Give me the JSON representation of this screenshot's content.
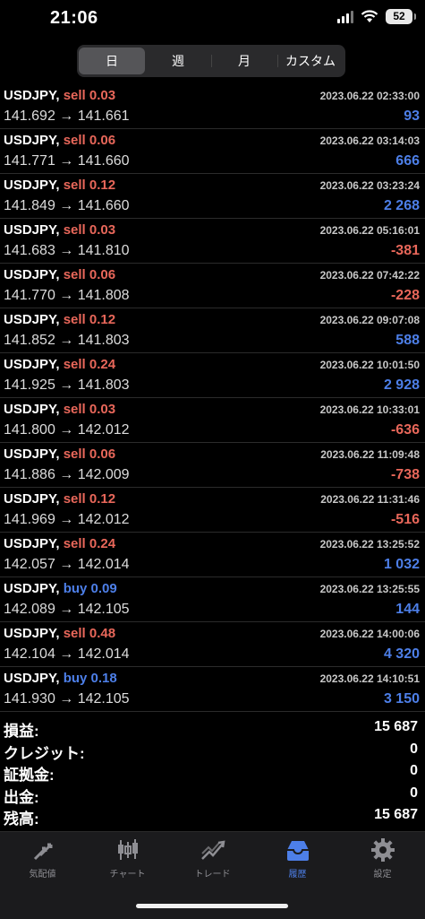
{
  "status": {
    "time": "21:06",
    "battery": "52"
  },
  "period_tabs": [
    "日",
    "週",
    "月",
    "カスタム"
  ],
  "trades": [
    {
      "symbol": "USDJPY,",
      "side": "sell",
      "volume": "0.03",
      "open": "141.692",
      "close": "141.661",
      "datetime": "2023.06.22 02:33:00",
      "profit": "93",
      "sign": "pos"
    },
    {
      "symbol": "USDJPY,",
      "side": "sell",
      "volume": "0.06",
      "open": "141.771",
      "close": "141.660",
      "datetime": "2023.06.22 03:14:03",
      "profit": "666",
      "sign": "pos"
    },
    {
      "symbol": "USDJPY,",
      "side": "sell",
      "volume": "0.12",
      "open": "141.849",
      "close": "141.660",
      "datetime": "2023.06.22 03:23:24",
      "profit": "2 268",
      "sign": "pos"
    },
    {
      "symbol": "USDJPY,",
      "side": "sell",
      "volume": "0.03",
      "open": "141.683",
      "close": "141.810",
      "datetime": "2023.06.22 05:16:01",
      "profit": "-381",
      "sign": "neg"
    },
    {
      "symbol": "USDJPY,",
      "side": "sell",
      "volume": "0.06",
      "open": "141.770",
      "close": "141.808",
      "datetime": "2023.06.22 07:42:22",
      "profit": "-228",
      "sign": "neg"
    },
    {
      "symbol": "USDJPY,",
      "side": "sell",
      "volume": "0.12",
      "open": "141.852",
      "close": "141.803",
      "datetime": "2023.06.22 09:07:08",
      "profit": "588",
      "sign": "pos"
    },
    {
      "symbol": "USDJPY,",
      "side": "sell",
      "volume": "0.24",
      "open": "141.925",
      "close": "141.803",
      "datetime": "2023.06.22 10:01:50",
      "profit": "2 928",
      "sign": "pos"
    },
    {
      "symbol": "USDJPY,",
      "side": "sell",
      "volume": "0.03",
      "open": "141.800",
      "close": "142.012",
      "datetime": "2023.06.22 10:33:01",
      "profit": "-636",
      "sign": "neg"
    },
    {
      "symbol": "USDJPY,",
      "side": "sell",
      "volume": "0.06",
      "open": "141.886",
      "close": "142.009",
      "datetime": "2023.06.22 11:09:48",
      "profit": "-738",
      "sign": "neg"
    },
    {
      "symbol": "USDJPY,",
      "side": "sell",
      "volume": "0.12",
      "open": "141.969",
      "close": "142.012",
      "datetime": "2023.06.22 11:31:46",
      "profit": "-516",
      "sign": "neg"
    },
    {
      "symbol": "USDJPY,",
      "side": "sell",
      "volume": "0.24",
      "open": "142.057",
      "close": "142.014",
      "datetime": "2023.06.22 13:25:52",
      "profit": "1 032",
      "sign": "pos"
    },
    {
      "symbol": "USDJPY,",
      "side": "buy",
      "volume": "0.09",
      "open": "142.089",
      "close": "142.105",
      "datetime": "2023.06.22 13:25:55",
      "profit": "144",
      "sign": "pos"
    },
    {
      "symbol": "USDJPY,",
      "side": "sell",
      "volume": "0.48",
      "open": "142.104",
      "close": "142.014",
      "datetime": "2023.06.22 14:00:06",
      "profit": "4 320",
      "sign": "pos"
    },
    {
      "symbol": "USDJPY,",
      "side": "buy",
      "volume": "0.18",
      "open": "141.930",
      "close": "142.105",
      "datetime": "2023.06.22 14:10:51",
      "profit": "3 150",
      "sign": "pos"
    }
  ],
  "summary": [
    {
      "label": "損益:",
      "value": "15 687"
    },
    {
      "label": "クレジット:",
      "value": "0"
    },
    {
      "label": "証拠金:",
      "value": "0"
    },
    {
      "label": "出金:",
      "value": "0"
    },
    {
      "label": "残高:",
      "value": "15 687"
    }
  ],
  "tabbar": [
    {
      "label": "気配値",
      "icon": "quotes-icon"
    },
    {
      "label": "チャート",
      "icon": "chart-icon"
    },
    {
      "label": "トレード",
      "icon": "trade-icon"
    },
    {
      "label": "履歴",
      "icon": "history-icon",
      "active": true
    },
    {
      "label": "設定",
      "icon": "settings-icon"
    }
  ],
  "colors": {
    "sell": "#e8675a",
    "buy": "#4d7fe8",
    "positive": "#4d7fe8",
    "negative": "#e8675a"
  }
}
